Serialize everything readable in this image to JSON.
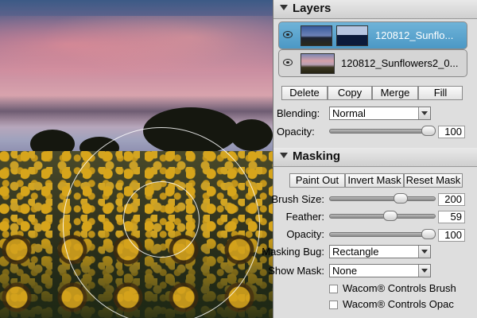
{
  "layers": {
    "title": "Layers",
    "items": [
      {
        "name": "120812_Sunflo...",
        "selected": true
      },
      {
        "name": "120812_Sunflowers2_0...",
        "selected": false
      }
    ],
    "buttons": {
      "delete": "Delete",
      "copy": "Copy",
      "merge": "Merge",
      "fill": "Fill"
    },
    "blending_label": "Blending:",
    "blending_value": "Normal",
    "opacity_label": "Opacity:",
    "opacity_value": "100",
    "opacity_fraction": 1.0
  },
  "masking": {
    "title": "Masking",
    "buttons": {
      "paint_out": "Paint Out",
      "invert_mask": "Invert Mask",
      "reset_mask": "Reset Mask"
    },
    "brush_size_label": "Brush Size:",
    "brush_size_value": "200",
    "brush_size_fraction": 0.7,
    "feather_label": "Feather:",
    "feather_value": "59",
    "feather_fraction": 0.59,
    "opacity_label": "Opacity:",
    "opacity_value": "100",
    "opacity_fraction": 1.0,
    "masking_bug_label": "Masking Bug:",
    "masking_bug_value": "Rectangle",
    "show_mask_label": "Show Mask:",
    "show_mask_value": "None",
    "wacom_brush_label": "Wacom® Controls Brush",
    "wacom_opacity_label": "Wacom® Controls Opac"
  },
  "colors": {
    "selected_layer": "#5aa6d0",
    "panel_bg": "#dedede"
  }
}
